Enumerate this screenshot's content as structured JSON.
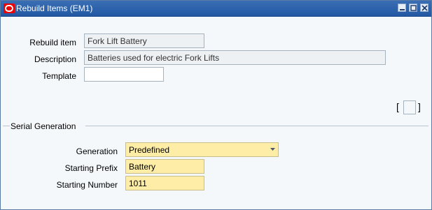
{
  "window": {
    "title": "Rebuild Items (EM1)",
    "icon": "oracle-icon",
    "controls": [
      "minimize-icon",
      "maximize-icon",
      "close-icon"
    ]
  },
  "form": {
    "rebuild_item": {
      "label": "Rebuild item",
      "value": "Fork Lift Battery"
    },
    "description": {
      "label": "Description",
      "value": "Batteries used for electric Fork Lifts"
    },
    "template": {
      "label": "Template",
      "value": ""
    },
    "flex_open": "[",
    "flex_close": "]"
  },
  "serial_generation": {
    "title": "Serial Generation",
    "generation": {
      "label": "Generation",
      "value": "Predefined"
    },
    "starting_prefix": {
      "label": "Starting Prefix",
      "value": "Battery"
    },
    "starting_number": {
      "label": "Starting Number",
      "value": "1011"
    }
  },
  "colors": {
    "titlebar": "#2a62ad",
    "required_field": "#fdeda6",
    "readonly_field": "#eef1f4"
  }
}
